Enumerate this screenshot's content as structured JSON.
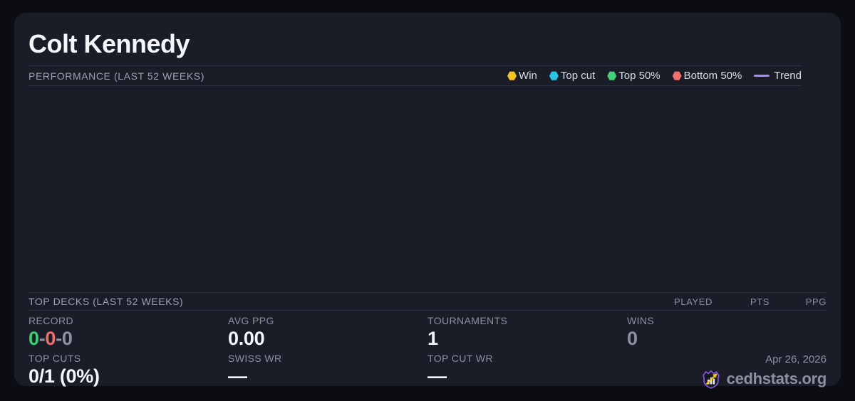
{
  "colors": {
    "page-bg": "#0c0d12",
    "card-bg": "#1a1d27",
    "border": "#2c3140",
    "text-primary": "#f3f5f8",
    "text-muted": "#8a91a0",
    "legend-text": "#d9dde4",
    "win": "#f0c420",
    "top-cut": "#29c5e6",
    "top-50": "#45d17b",
    "bottom-50": "#f27070",
    "trend": "#a78bfa",
    "record-win": "#3fcf74",
    "record-loss": "#ef6e6e",
    "record-draw": "#8a91a0",
    "brand-purple": "#8655e0",
    "brand-gold": "#f0c420"
  },
  "player": {
    "name": "Colt Kennedy"
  },
  "performance": {
    "title": "PERFORMANCE (LAST 52 WEEKS)",
    "legend": {
      "win": "Win",
      "top_cut": "Top cut",
      "top_50": "Top 50%",
      "bottom_50": "Bottom 50%",
      "trend": "Trend"
    }
  },
  "chart_data": {
    "type": "scatter",
    "title": "PERFORMANCE (LAST 52 WEEKS)",
    "series": [],
    "x": [],
    "legend_entries": [
      "Win",
      "Top cut",
      "Top 50%",
      "Bottom 50%",
      "Trend"
    ],
    "legend_position": "top-right",
    "grid": false
  },
  "top_decks": {
    "title": "TOP DECKS (LAST 52 WEEKS)",
    "columns": [
      "PLAYED",
      "PTS",
      "PPG"
    ],
    "rows": []
  },
  "stats": {
    "record": {
      "label": "RECORD",
      "wins": "0",
      "losses": "0",
      "draws": "0",
      "separator": "-"
    },
    "avg_ppg": {
      "label": "AVG PPG",
      "value": "0.00"
    },
    "tournaments": {
      "label": "TOURNAMENTS",
      "value": "1"
    },
    "wins": {
      "label": "WINS",
      "value": "0"
    },
    "top_cuts": {
      "label": "TOP CUTS",
      "value": "0/1 (0%)"
    },
    "swiss_wr": {
      "label": "SWISS WR",
      "value": "—"
    },
    "top_cut_wr": {
      "label": "TOP CUT WR",
      "value": "—"
    }
  },
  "footer": {
    "date": "Apr 26, 2026",
    "brand": "cedhstats.org"
  }
}
